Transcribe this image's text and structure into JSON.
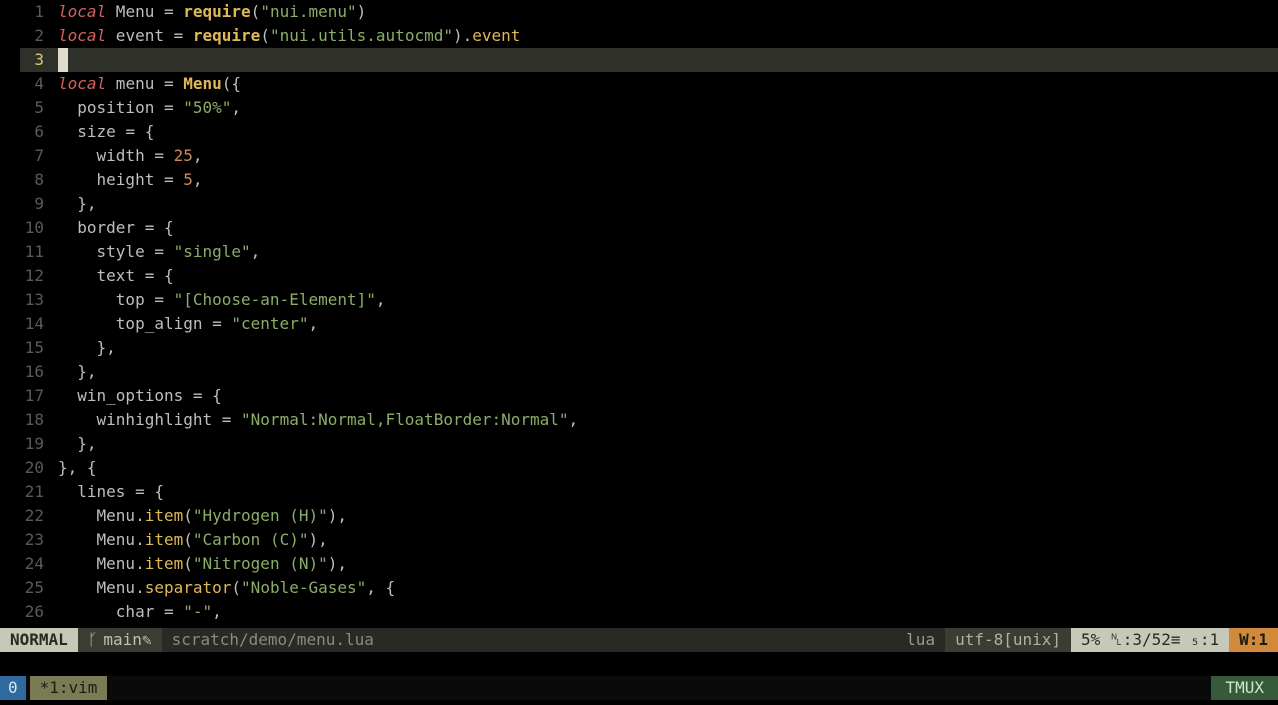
{
  "gutter": {
    "lines": [
      "1",
      "2",
      "3",
      "4",
      "5",
      "6",
      "7",
      "8",
      "9",
      "10",
      "11",
      "12",
      "13",
      "14",
      "15",
      "16",
      "17",
      "18",
      "19",
      "20",
      "21",
      "22",
      "23",
      "24",
      "25",
      "26"
    ],
    "current_index": 2
  },
  "code": {
    "lines": [
      [
        {
          "c": "kw",
          "t": "local"
        },
        {
          "c": "ident",
          "t": " Menu "
        },
        {
          "c": "punc",
          "t": "= "
        },
        {
          "c": "fn",
          "t": "require"
        },
        {
          "c": "punc",
          "t": "("
        },
        {
          "c": "str",
          "t": "\"nui.menu\""
        },
        {
          "c": "punc",
          "t": ")"
        }
      ],
      [
        {
          "c": "kw",
          "t": "local"
        },
        {
          "c": "ident",
          "t": " event "
        },
        {
          "c": "punc",
          "t": "= "
        },
        {
          "c": "fn",
          "t": "require"
        },
        {
          "c": "punc",
          "t": "("
        },
        {
          "c": "str",
          "t": "\"nui.utils.autocmd\""
        },
        {
          "c": "punc",
          "t": ")."
        },
        {
          "c": "fnnl",
          "t": "event"
        }
      ],
      [
        {
          "c": "ident",
          "t": ""
        }
      ],
      [
        {
          "c": "kw",
          "t": "local"
        },
        {
          "c": "ident",
          "t": " menu "
        },
        {
          "c": "punc",
          "t": "= "
        },
        {
          "c": "fn",
          "t": "Menu"
        },
        {
          "c": "punc",
          "t": "({"
        }
      ],
      [
        {
          "c": "ident",
          "t": "  position "
        },
        {
          "c": "punc",
          "t": "= "
        },
        {
          "c": "str",
          "t": "\"50%\""
        },
        {
          "c": "punc",
          "t": ","
        }
      ],
      [
        {
          "c": "ident",
          "t": "  size "
        },
        {
          "c": "punc",
          "t": "= {"
        }
      ],
      [
        {
          "c": "ident",
          "t": "    width "
        },
        {
          "c": "punc",
          "t": "= "
        },
        {
          "c": "num",
          "t": "25"
        },
        {
          "c": "punc",
          "t": ","
        }
      ],
      [
        {
          "c": "ident",
          "t": "    height "
        },
        {
          "c": "punc",
          "t": "= "
        },
        {
          "c": "num",
          "t": "5"
        },
        {
          "c": "punc",
          "t": ","
        }
      ],
      [
        {
          "c": "punc",
          "t": "  },"
        }
      ],
      [
        {
          "c": "ident",
          "t": "  border "
        },
        {
          "c": "punc",
          "t": "= {"
        }
      ],
      [
        {
          "c": "ident",
          "t": "    style "
        },
        {
          "c": "punc",
          "t": "= "
        },
        {
          "c": "str",
          "t": "\"single\""
        },
        {
          "c": "punc",
          "t": ","
        }
      ],
      [
        {
          "c": "ident",
          "t": "    text "
        },
        {
          "c": "punc",
          "t": "= {"
        }
      ],
      [
        {
          "c": "ident",
          "t": "      top "
        },
        {
          "c": "punc",
          "t": "= "
        },
        {
          "c": "str",
          "t": "\"[Choose-an-Element]\""
        },
        {
          "c": "punc",
          "t": ","
        }
      ],
      [
        {
          "c": "ident",
          "t": "      top_align "
        },
        {
          "c": "punc",
          "t": "= "
        },
        {
          "c": "str",
          "t": "\"center\""
        },
        {
          "c": "punc",
          "t": ","
        }
      ],
      [
        {
          "c": "punc",
          "t": "    },"
        }
      ],
      [
        {
          "c": "punc",
          "t": "  },"
        }
      ],
      [
        {
          "c": "ident",
          "t": "  win_options "
        },
        {
          "c": "punc",
          "t": "= {"
        }
      ],
      [
        {
          "c": "ident",
          "t": "    winhighlight "
        },
        {
          "c": "punc",
          "t": "= "
        },
        {
          "c": "str",
          "t": "\"Normal:Normal,FloatBorder:Normal\""
        },
        {
          "c": "punc",
          "t": ","
        }
      ],
      [
        {
          "c": "punc",
          "t": "  },"
        }
      ],
      [
        {
          "c": "punc",
          "t": "}, {"
        }
      ],
      [
        {
          "c": "ident",
          "t": "  lines "
        },
        {
          "c": "punc",
          "t": "= {"
        }
      ],
      [
        {
          "c": "ident",
          "t": "    Menu."
        },
        {
          "c": "fnnl",
          "t": "item"
        },
        {
          "c": "punc",
          "t": "("
        },
        {
          "c": "str",
          "t": "\"Hydrogen (H)\""
        },
        {
          "c": "punc",
          "t": "),"
        }
      ],
      [
        {
          "c": "ident",
          "t": "    Menu."
        },
        {
          "c": "fnnl",
          "t": "item"
        },
        {
          "c": "punc",
          "t": "("
        },
        {
          "c": "str",
          "t": "\"Carbon (C)\""
        },
        {
          "c": "punc",
          "t": "),"
        }
      ],
      [
        {
          "c": "ident",
          "t": "    Menu."
        },
        {
          "c": "fnnl",
          "t": "item"
        },
        {
          "c": "punc",
          "t": "("
        },
        {
          "c": "str",
          "t": "\"Nitrogen (N)\""
        },
        {
          "c": "punc",
          "t": "),"
        }
      ],
      [
        {
          "c": "ident",
          "t": "    Menu."
        },
        {
          "c": "fnnl",
          "t": "separator"
        },
        {
          "c": "punc",
          "t": "("
        },
        {
          "c": "str",
          "t": "\"Noble-Gases\""
        },
        {
          "c": "punc",
          "t": ", {"
        }
      ],
      [
        {
          "c": "ident",
          "t": "      char "
        },
        {
          "c": "punc",
          "t": "= "
        },
        {
          "c": "str",
          "t": "\"-\""
        },
        {
          "c": "punc",
          "t": ","
        }
      ]
    ]
  },
  "statusline": {
    "mode": "NORMAL",
    "branch_icon": "ᚴ",
    "branch": "main",
    "dirty": "✎",
    "file": "scratch/demo/menu.lua",
    "filetype": "lua",
    "encoding": "utf-8[unix]",
    "percent": "5%",
    "lineinfo_a": "␤:3/52",
    "lineinfo_b": "≡ ₅:1",
    "warn": "W:1"
  },
  "tmux": {
    "session": "0",
    "window": "*1:vim",
    "name": "TMUX"
  }
}
